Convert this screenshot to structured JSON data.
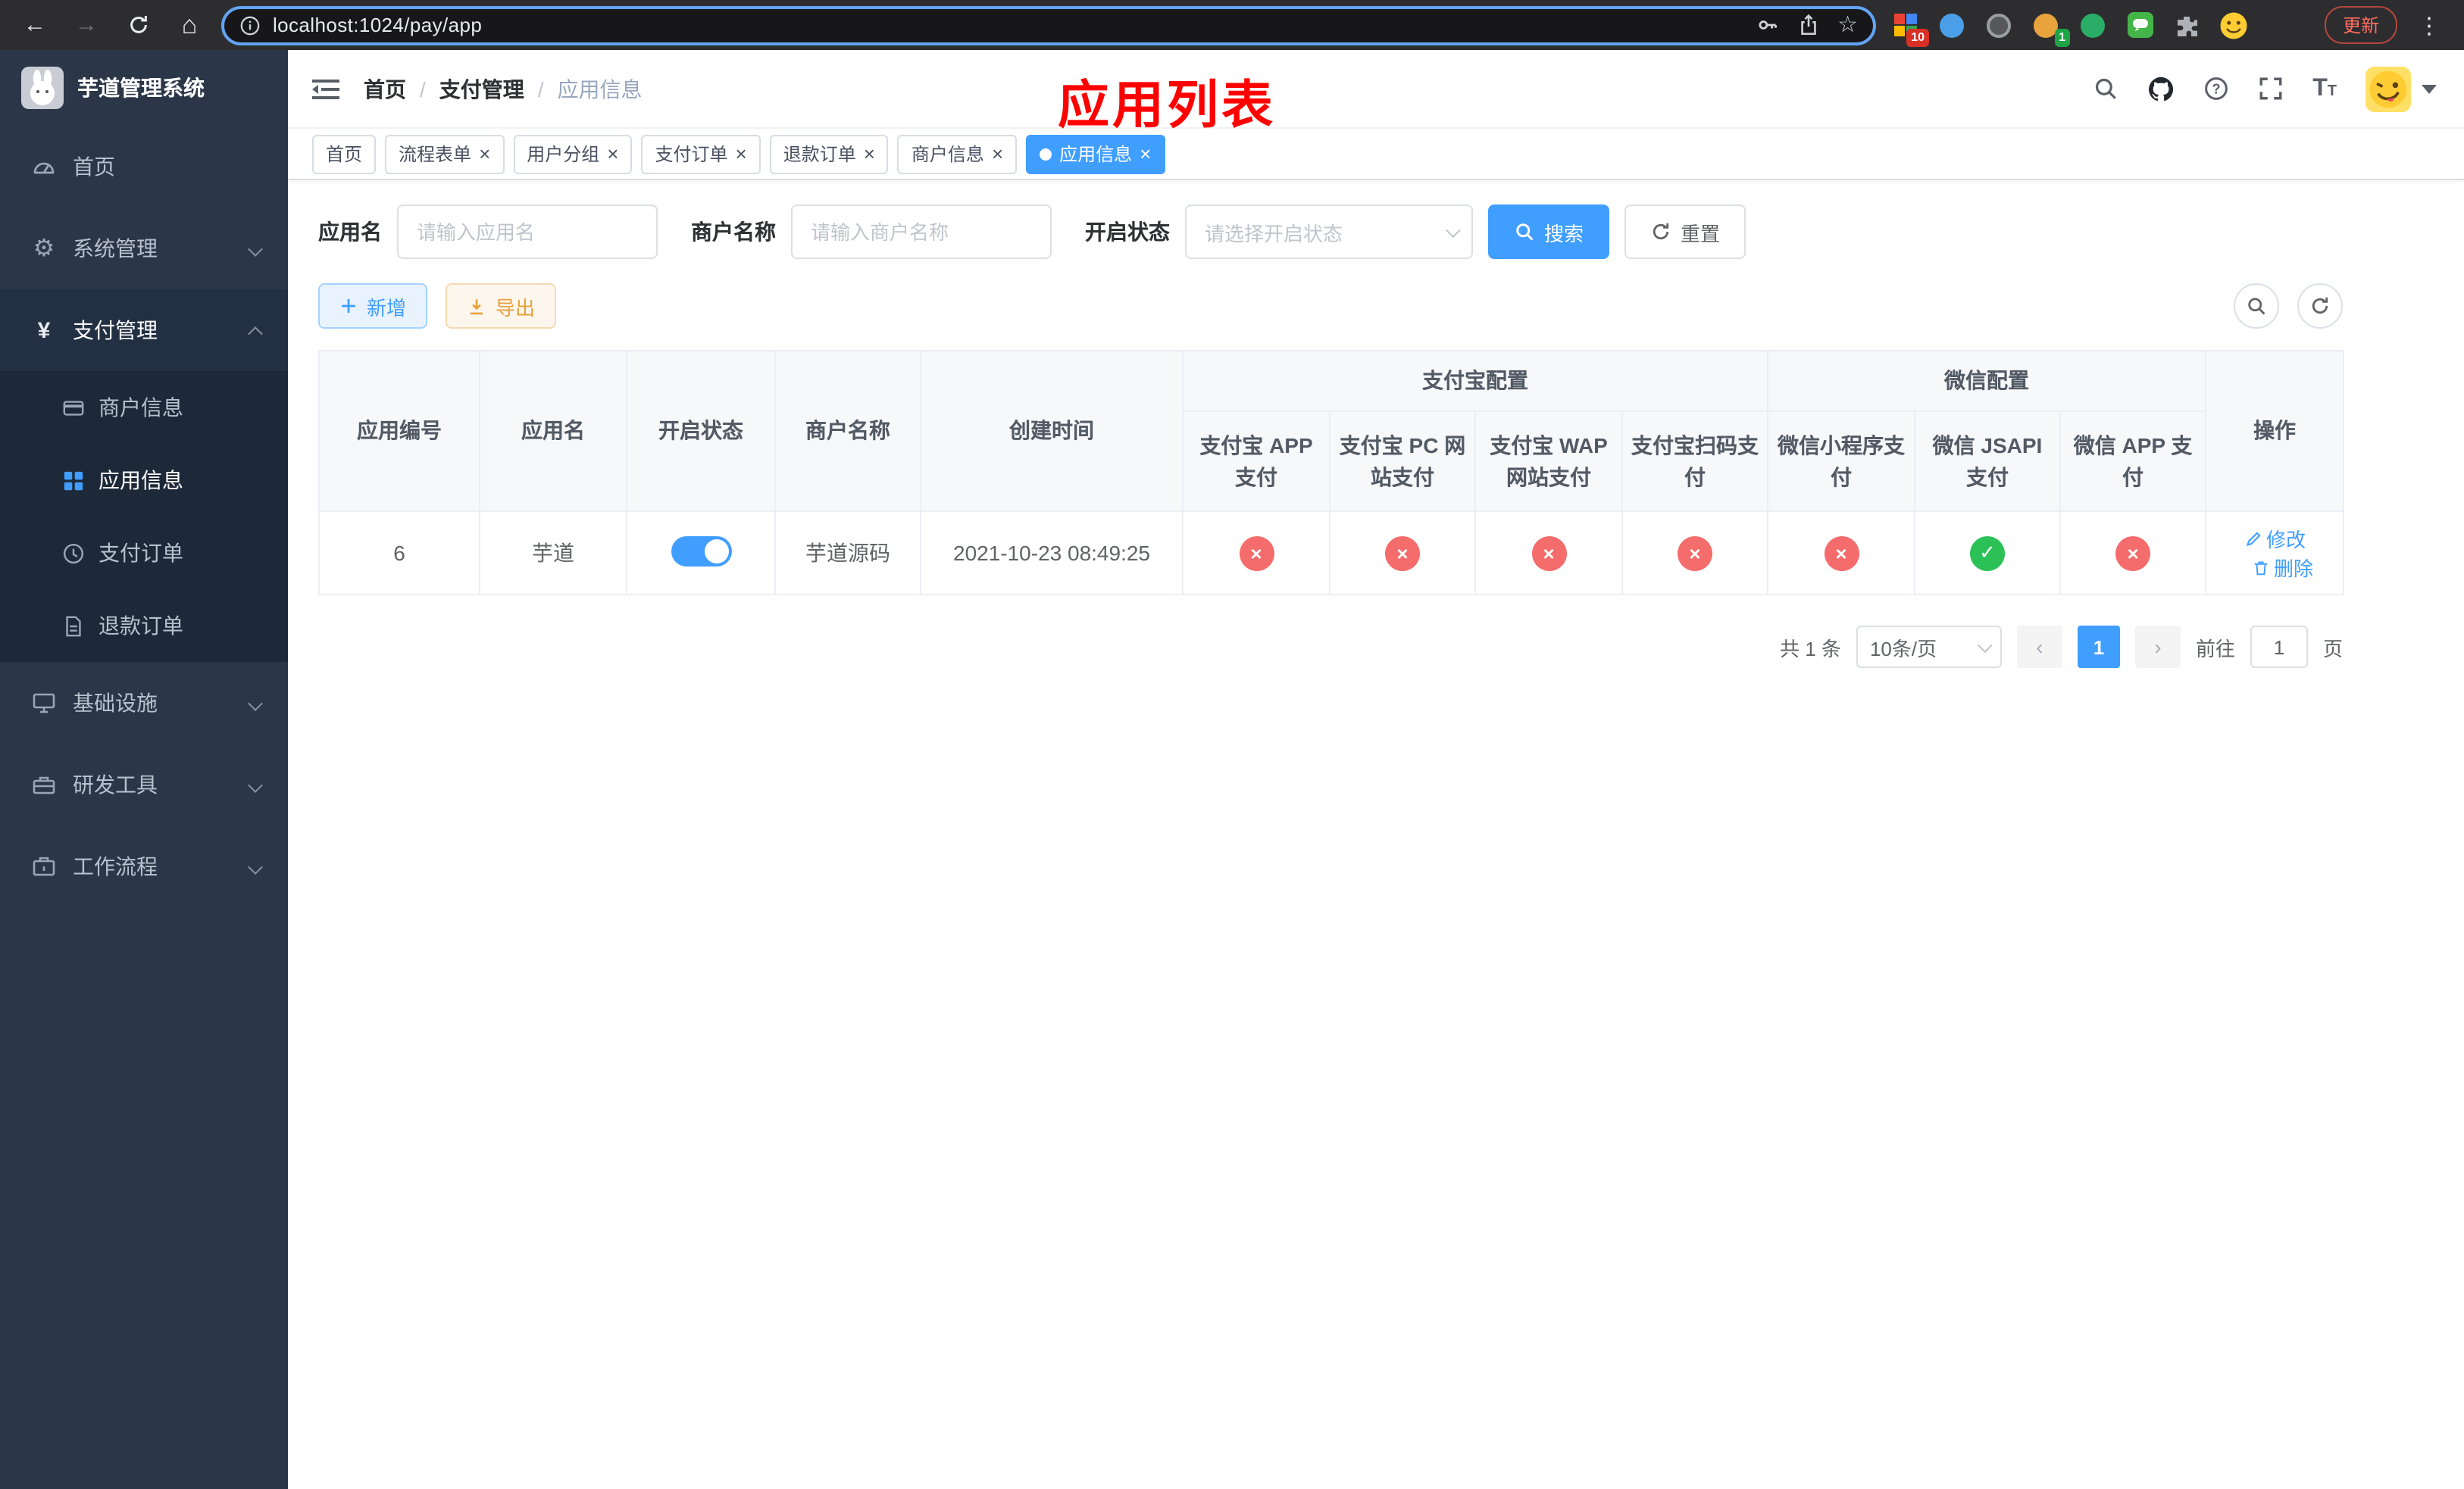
{
  "browser": {
    "url": "localhost:1024/pay/app",
    "update_label": "更新",
    "ext_badge_grid": "10",
    "ext_badge_avatar": "1"
  },
  "annotation": {
    "page_title": "应用列表"
  },
  "sidebar": {
    "app_title": "芋道管理系统",
    "items": [
      {
        "label": "首页"
      },
      {
        "label": "系统管理"
      },
      {
        "label": "支付管理",
        "children": [
          {
            "label": "商户信息"
          },
          {
            "label": "应用信息"
          },
          {
            "label": "支付订单"
          },
          {
            "label": "退款订单"
          }
        ]
      },
      {
        "label": "基础设施"
      },
      {
        "label": "研发工具"
      },
      {
        "label": "工作流程"
      }
    ]
  },
  "navbar": {
    "breadcrumb": [
      "首页",
      "支付管理",
      "应用信息"
    ]
  },
  "tabs": [
    {
      "label": "首页"
    },
    {
      "label": "流程表单"
    },
    {
      "label": "用户分组"
    },
    {
      "label": "支付订单"
    },
    {
      "label": "退款订单"
    },
    {
      "label": "商户信息"
    },
    {
      "label": "应用信息"
    }
  ],
  "filters": {
    "app_name_label": "应用名",
    "app_name_placeholder": "请输入应用名",
    "merchant_label": "商户名称",
    "merchant_placeholder": "请输入商户名称",
    "status_label": "开启状态",
    "status_placeholder": "请选择开启状态",
    "search_label": "搜索",
    "reset_label": "重置"
  },
  "toolbar": {
    "add_label": "新增",
    "export_label": "导出"
  },
  "table": {
    "col_app_id": "应用编号",
    "col_app_name": "应用名",
    "col_status": "开启状态",
    "col_merchant": "商户名称",
    "col_created": "创建时间",
    "group_alipay": "支付宝配置",
    "group_wechat": "微信配置",
    "col_alipay_app": "支付宝 APP 支付",
    "col_alipay_pc": "支付宝 PC 网站支付",
    "col_alipay_wap": "支付宝 WAP 网站支付",
    "col_alipay_qr": "支付宝扫码支付",
    "col_wx_mini": "微信小程序支付",
    "col_wx_jsapi": "微信 JSAPI 支付",
    "col_wx_app": "微信 APP 支付",
    "col_actions": "操作",
    "row": {
      "id": "6",
      "name": "芋道",
      "enabled": true,
      "merchant": "芋道源码",
      "created": "2021-10-23 08:49:25",
      "alipay_app": false,
      "alipay_pc": false,
      "alipay_wap": false,
      "alipay_qr": false,
      "wx_mini": false,
      "wx_jsapi": true,
      "wx_app": false,
      "edit_label": "修改",
      "delete_label": "删除"
    }
  },
  "pagination": {
    "total": "共 1 条",
    "page_size": "10条/页",
    "page": "1",
    "goto_label": "前往",
    "goto_value": "1",
    "goto_suffix": "页"
  },
  "colors": {
    "primary": "#409eff",
    "success": "#2cc156",
    "danger": "#f56c6c",
    "annotation_red": "#ff0000"
  }
}
